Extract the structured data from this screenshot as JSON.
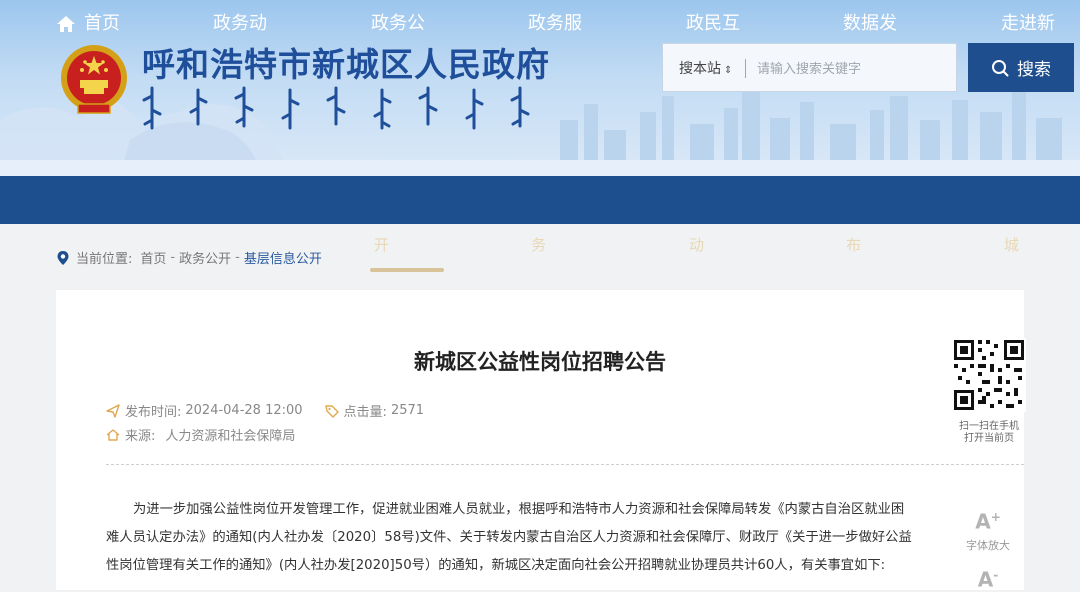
{
  "header": {
    "site_title": "呼和浩特市新城区人民政府",
    "search": {
      "scope_label": "搜本站",
      "placeholder": "请输入搜索关键字",
      "button_label": "搜索"
    }
  },
  "nav": {
    "items": [
      {
        "label": "首页",
        "overflow": ""
      },
      {
        "label": "政务动",
        "overflow": ""
      },
      {
        "label": "政务公",
        "overflow": "开"
      },
      {
        "label": "政务服",
        "overflow": "务"
      },
      {
        "label": "政民互",
        "overflow": "动"
      },
      {
        "label": "数据发",
        "overflow": "布"
      },
      {
        "label": "走进新",
        "overflow": "城"
      }
    ]
  },
  "breadcrumb": {
    "prefix": "当前位置:",
    "items": [
      "首页",
      "政务公开",
      "基层信息公开"
    ],
    "separator": "-"
  },
  "article": {
    "title": "新城区公益性岗位招聘公告",
    "publish_label": "发布时间:",
    "publish_time": "2024-04-28 12:00",
    "views_label": "点击量:",
    "views": "2571",
    "source_label": "来源:",
    "source": "人力资源和社会保障局",
    "qr_caption_line1": "扫一扫在手机",
    "qr_caption_line2": "打开当前页",
    "body": "为进一步加强公益性岗位开发管理工作，促进就业困难人员就业，根据呼和浩特市人力资源和社会保障局转发《内蒙古自治区就业困难人员认定办法》的通知(内人社办发〔2020〕58号)文件、关于转发内蒙古自治区人力资源和社会保障厅、财政厅《关于进一步做好公益性岗位管理有关工作的通知》(内人社办发[2020]50号）的通知，新城区决定面向社会公开招聘就业协理员共计60人，有关事宜如下:"
  },
  "tools": {
    "font_larger_label": "字体放大",
    "font_larger_glyph": "A",
    "font_larger_sign": "+",
    "font_smaller_glyph": "A",
    "font_smaller_sign": "-"
  },
  "colors": {
    "nav_bg": "#1d4f8f",
    "title_blue": "#1f4e9a",
    "accent_gold": "#d9c39a"
  }
}
